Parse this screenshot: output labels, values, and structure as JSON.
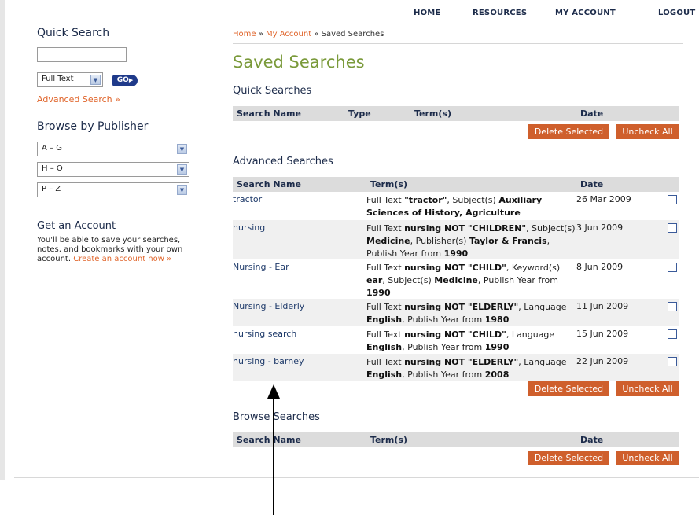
{
  "nav": {
    "home": "HOME",
    "resources": "RESOURCES",
    "my_account": "MY ACCOUNT",
    "logout": "LOGOUT"
  },
  "sidebar": {
    "quick_search_title": "Quick Search",
    "search_value": "",
    "search_type": "Full Text",
    "go_label": "GO",
    "advanced_link": "Advanced Search »",
    "browse_title": "Browse by Publisher",
    "publisher_ranges": [
      "A – G",
      "H – O",
      "P – Z"
    ],
    "account_title": "Get an Account",
    "account_text": "You'll be able to save your searches, notes, and bookmarks with your own account.",
    "create_link": "Create an account now »"
  },
  "breadcrumb": {
    "home": "Home",
    "sep": " » ",
    "my_account": "My Account",
    "current": "Saved Searches"
  },
  "page_title": "Saved Searches",
  "quick": {
    "title": "Quick Searches",
    "headers": {
      "name": "Search Name",
      "type": "Type",
      "terms": "Term(s)",
      "date": "Date"
    }
  },
  "advanced": {
    "title": "Advanced Searches",
    "headers": {
      "name": "Search Name",
      "terms": "Term(s)",
      "date": "Date"
    },
    "rows": [
      {
        "name": "tractor",
        "date": "26 Mar 2009"
      },
      {
        "name": "nursing",
        "date": "3 Jun 2009"
      },
      {
        "name": "Nursing - Ear",
        "date": "8 Jun 2009"
      },
      {
        "name": "Nursing - Elderly",
        "date": "11 Jun 2009"
      },
      {
        "name": "nursing search",
        "date": "15 Jun 2009"
      },
      {
        "name": "nursing - barney",
        "date": "22 Jun 2009"
      }
    ]
  },
  "browse": {
    "title": "Browse Searches",
    "headers": {
      "name": "Search Name",
      "terms": "Term(s)",
      "date": "Date"
    }
  },
  "buttons": {
    "delete": "Delete Selected",
    "uncheck": "Uncheck All"
  }
}
